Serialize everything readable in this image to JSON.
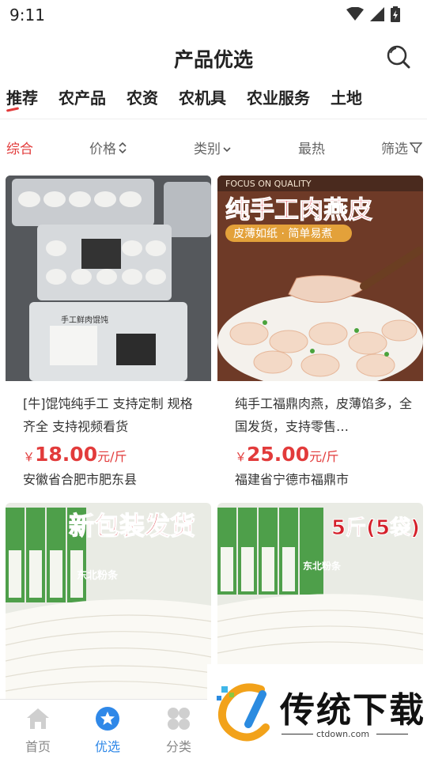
{
  "status": {
    "time": "9:11"
  },
  "header": {
    "title": "产品优选"
  },
  "category_tabs": [
    {
      "label": "推荐"
    },
    {
      "label": "农产品"
    },
    {
      "label": "农资"
    },
    {
      "label": "农机具"
    },
    {
      "label": "农业服务"
    },
    {
      "label": "土地"
    }
  ],
  "sort": {
    "comprehensive": "综合",
    "price": "价格",
    "category": "类别",
    "hottest": "最热",
    "filter": "筛选"
  },
  "products": [
    {
      "title": "[牛]馄饨纯手工 支持定制 规格齐全 支持视频看货",
      "currency": "￥",
      "price": "18.00",
      "unit": "元/斤",
      "location": "安徽省合肥市肥东县",
      "image_label": "手工鲜肉馄饨"
    },
    {
      "title": "纯手工福鼎肉燕，皮薄馅多，全国发货，支持零售…",
      "currency": "￥",
      "price": "25.00",
      "unit": "元/斤",
      "location": "福建省宁德市福鼎市",
      "image_banner_top": "FOCUS ON QUALITY",
      "image_headline": "纯手工肉燕皮",
      "image_subline": "皮薄如纸 · 简单易煮"
    },
    {
      "image_headline": "新包装发货",
      "image_pack_label": "东北粉条"
    },
    {
      "image_headline": "5斤(5袋)",
      "image_pack_label": "东北粉条"
    }
  ],
  "bottom_nav": [
    {
      "label": "首页"
    },
    {
      "label": "优选"
    },
    {
      "label": "分类"
    }
  ],
  "watermark": {
    "text": "传统下载",
    "url": "ctdown.com"
  },
  "colors": {
    "accent": "#e23b3b",
    "nav_active": "#2f88e8"
  }
}
